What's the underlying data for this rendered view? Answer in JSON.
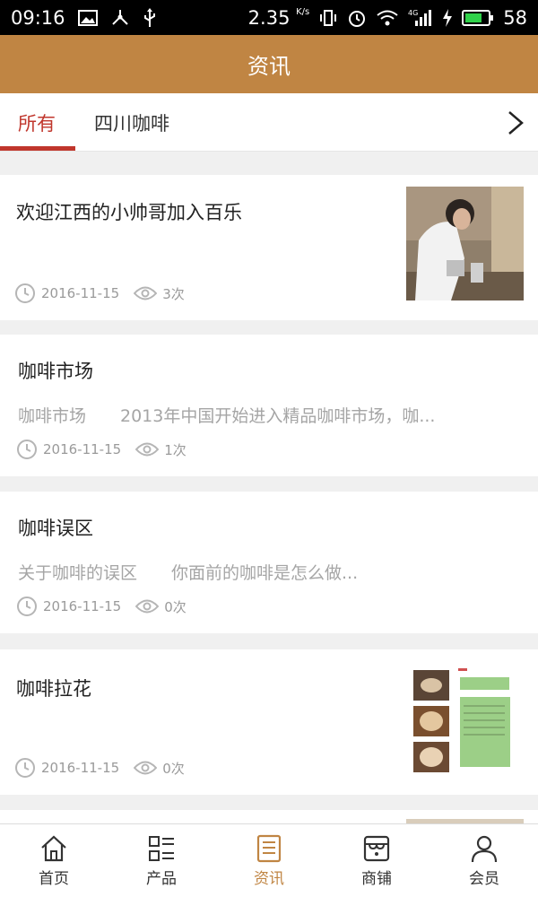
{
  "status_bar": {
    "time": "09:16",
    "speed": "2.35",
    "speed_unit": "K/s",
    "network": "4G",
    "battery": "58"
  },
  "header": {
    "title": "资讯"
  },
  "tabs": [
    {
      "label": "所有",
      "active": true
    },
    {
      "label": "四川咖啡",
      "active": false
    }
  ],
  "news": [
    {
      "title": "欢迎江西的小帅哥加入百乐",
      "summary": "",
      "date": "2016-11-15",
      "views": "3次",
      "thumbnail": "photo-barista"
    },
    {
      "title": "咖啡市场",
      "summary": "咖啡市场　　2013年中国开始进入精品咖啡市场，咖...",
      "date": "2016-11-15",
      "views": "1次",
      "thumbnail": ""
    },
    {
      "title": "咖啡误区",
      "summary": "关于咖啡的误区　　你面前的咖啡是怎么做...",
      "date": "2016-11-15",
      "views": "0次",
      "thumbnail": ""
    },
    {
      "title": "咖啡拉花",
      "summary": "",
      "date": "2016-11-15",
      "views": "0次",
      "thumbnail": "latte-art-document"
    }
  ],
  "bottom_nav": [
    {
      "label": "首页",
      "icon": "home-icon",
      "active": false
    },
    {
      "label": "产品",
      "icon": "grid-list-icon",
      "active": false
    },
    {
      "label": "资讯",
      "icon": "news-icon",
      "active": true
    },
    {
      "label": "商铺",
      "icon": "store-icon",
      "active": false
    },
    {
      "label": "会员",
      "icon": "user-icon",
      "active": false
    }
  ],
  "colors": {
    "header_bg": "#c08543",
    "accent_red": "#c0362c",
    "active_nav": "#c08543"
  }
}
